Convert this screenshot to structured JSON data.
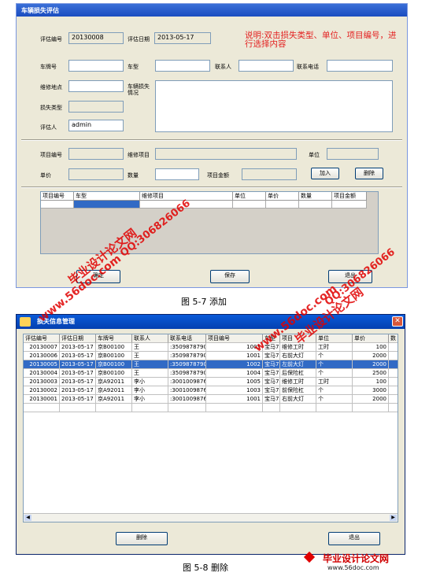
{
  "window1": {
    "title": "车辆损失评估",
    "labels": {
      "eval_no": "评估编号",
      "eval_date": "评估日期",
      "plate": "车牌号",
      "car_type": "车型",
      "contact": "联系人",
      "phone": "联系电话",
      "repair_place": "维修地点",
      "damage_desc": "车辆损失情况",
      "loss_type": "损失类型",
      "assessor": "评估人",
      "item_no": "项目编号",
      "repair_item": "维修项目",
      "unit": "单位",
      "unit_price": "单价",
      "quantity": "数量",
      "item_amount": "项目金额"
    },
    "values": {
      "eval_no": "20130008",
      "eval_date": "2013-05-17",
      "assessor": "admin"
    },
    "note": "说明:双击损失类型、单位、项目编号，进行选择内容",
    "buttons": {
      "add": "加入",
      "delete": "删除",
      "confirm": "确定",
      "save": "保存",
      "exit": "退出"
    },
    "grid_headers": [
      "项目编号",
      "车型",
      "维修项目",
      "单位",
      "单价",
      "数量",
      "项目金额"
    ],
    "caption": "图 5-7 添加"
  },
  "window2": {
    "title": "损失信息管理",
    "headers": [
      "评估编号",
      "评估日期",
      "车牌号",
      "联系人",
      "联系电话",
      "项目编号",
      "车型",
      "项目",
      "单位",
      "单价",
      "数"
    ],
    "rows": [
      [
        "20130007",
        "2013-05-17",
        "京B00100",
        "王",
        ":3509878790",
        "1005",
        "宝马750",
        "维修工时",
        "工时",
        "100"
      ],
      [
        "20130006",
        "2013-05-17",
        "京B00100",
        "王",
        ":3509878790",
        "1001",
        "宝马750",
        "右前大灯",
        "个",
        "2000"
      ],
      [
        "20130005",
        "2013-05-17",
        "京B00100",
        "王",
        ":3509878790",
        "1002",
        "宝马750",
        "左前大灯",
        "个",
        "2000"
      ],
      [
        "20130004",
        "2013-05-17",
        "京B00100",
        "王",
        ":3509878790",
        "1004",
        "宝马750",
        "后保险杠",
        "个",
        "2500"
      ],
      [
        "20130003",
        "2013-05-17",
        "京A92011",
        "李小",
        ":3001009876",
        "1005",
        "宝马750",
        "维修工时",
        "工时",
        "100"
      ],
      [
        "20130002",
        "2013-05-17",
        "京A92011",
        "李小",
        ":3001009876",
        "1003",
        "宝马750",
        "前保险杠",
        "个",
        "3000"
      ],
      [
        "20130001",
        "2013-05-17",
        "京A92011",
        "李小",
        ":3001009876",
        "1001",
        "宝马750",
        "右前大灯",
        "个",
        "2000"
      ]
    ],
    "buttons": {
      "delete": "删除",
      "exit": "退出"
    },
    "caption": "图 5-8 删除"
  },
  "watermarks": {
    "site": "www.56doc.com",
    "brand": "毕业设计论文网",
    "qq": "QQ:306826066"
  },
  "footer_logo": {
    "brand": "毕业设计论文网",
    "url": "www.56doc.com"
  },
  "colors": {
    "title_blue": "#1a4cc0",
    "selection": "#316ac5",
    "note_red": "#e32020",
    "watermark_red": "#e00000"
  }
}
